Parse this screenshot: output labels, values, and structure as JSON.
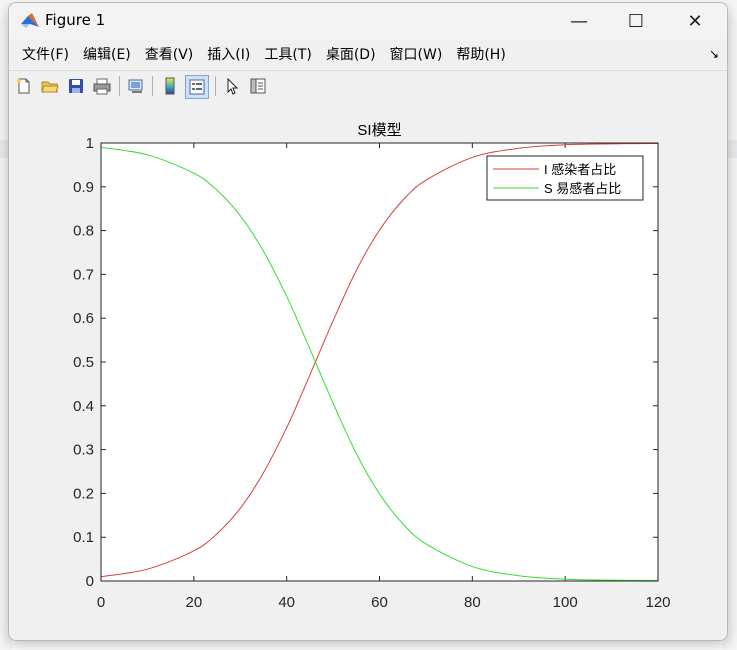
{
  "window": {
    "title": "Figure 1",
    "controls": {
      "minimize": "—",
      "maximize": "☐",
      "close": "✕"
    }
  },
  "menubar": {
    "items": [
      "文件(F)",
      "编辑(E)",
      "查看(V)",
      "插入(I)",
      "工具(T)",
      "桌面(D)",
      "窗口(W)",
      "帮助(H)"
    ],
    "dock_glyph": "↘"
  },
  "toolbar": {
    "icons": [
      "new-figure-icon",
      "open-file-icon",
      "save-icon",
      "print-icon",
      "link-figure-icon",
      "colorbar-icon",
      "legend-icon",
      "pointer-icon",
      "property-editor-icon"
    ]
  },
  "colors": {
    "series_I": "#d44040",
    "series_S": "#33dd33",
    "axes_bg": "#ffffff",
    "figure_bg": "#f0f0f0"
  },
  "chart_data": {
    "type": "line",
    "title": "SI模型",
    "xlabel": "",
    "ylabel": "",
    "xlim": [
      0,
      120
    ],
    "ylim": [
      0,
      1
    ],
    "xticks": [
      "0",
      "20",
      "40",
      "60",
      "80",
      "100",
      "120"
    ],
    "yticks": [
      "0",
      "0.1",
      "0.2",
      "0.3",
      "0.4",
      "0.5",
      "0.6",
      "0.7",
      "0.8",
      "0.9",
      "1"
    ],
    "grid": false,
    "legend_position": "top-right",
    "x": [
      0,
      10,
      20,
      25,
      30,
      35,
      40,
      43,
      46,
      50,
      55,
      60,
      65,
      70,
      80,
      90,
      100,
      110,
      120
    ],
    "series": [
      {
        "name": "I 感染者占比",
        "values": [
          0.01,
          0.027,
          0.069,
          0.108,
          0.166,
          0.247,
          0.35,
          0.421,
          0.495,
          0.594,
          0.709,
          0.801,
          0.869,
          0.915,
          0.967,
          0.988,
          0.996,
          0.998,
          0.999
        ]
      },
      {
        "name": "S 易感者占比",
        "values": [
          0.99,
          0.973,
          0.931,
          0.892,
          0.834,
          0.753,
          0.65,
          0.579,
          0.505,
          0.406,
          0.291,
          0.199,
          0.131,
          0.085,
          0.033,
          0.012,
          0.004,
          0.002,
          0.001
        ]
      }
    ]
  }
}
